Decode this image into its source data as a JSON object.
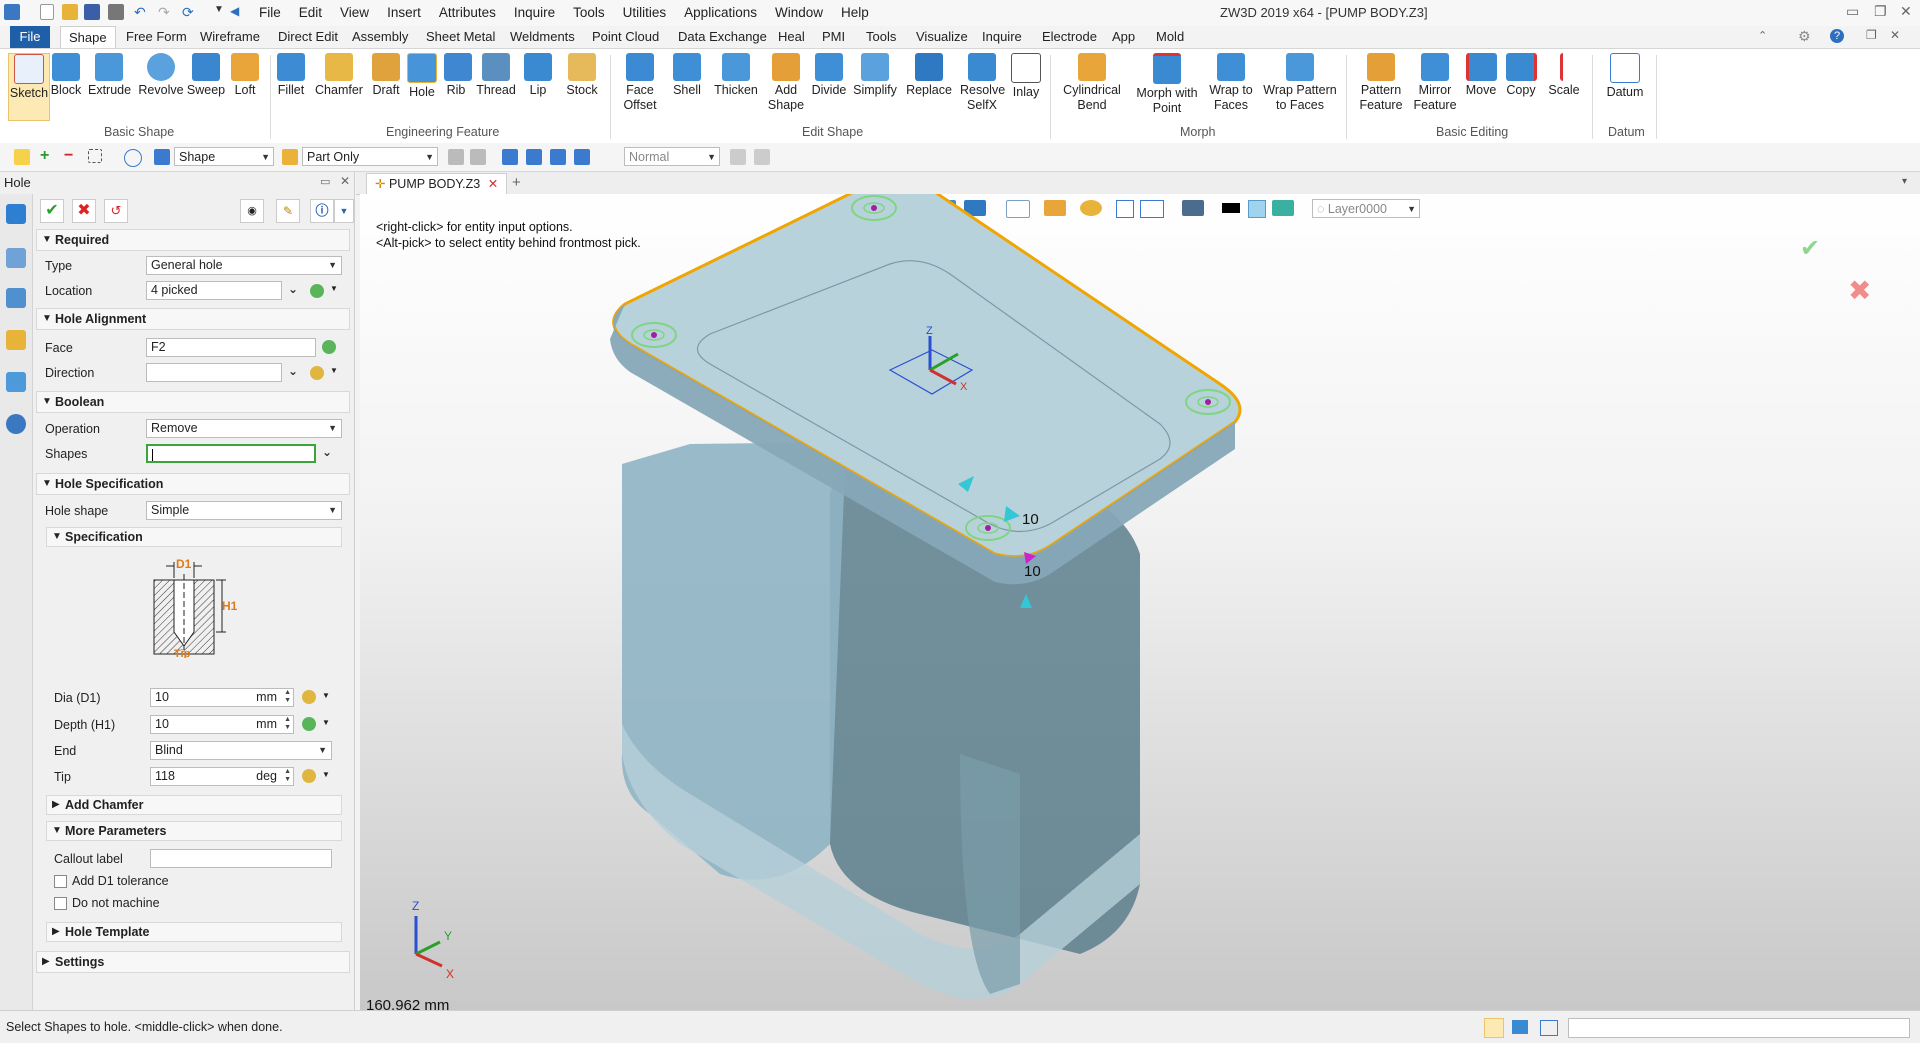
{
  "app": {
    "title": "ZW3D 2019  x64 - [PUMP BODY.Z3]",
    "menu": [
      "File",
      "Edit",
      "View",
      "Insert",
      "Attributes",
      "Inquire",
      "Tools",
      "Utilities",
      "Applications",
      "Window",
      "Help"
    ]
  },
  "ribbon_tabs": [
    "File",
    "Shape",
    "Free Form",
    "Wireframe",
    "Direct Edit",
    "Assembly",
    "Sheet Metal",
    "Weldments",
    "Point Cloud",
    "Data Exchange",
    "Heal",
    "PMI",
    "Tools",
    "Visualize",
    "Inquire",
    "Electrode",
    "App",
    "Mold"
  ],
  "ribbon": {
    "groups": [
      {
        "label": "Basic Shape",
        "buttons": [
          "Sketch",
          "Block",
          "Extrude",
          "Revolve",
          "Sweep",
          "Loft"
        ]
      },
      {
        "label": "Engineering Feature",
        "buttons": [
          "Fillet",
          "Chamfer",
          "Draft",
          "Hole",
          "Rib",
          "Thread",
          "Lip",
          "Stock"
        ]
      },
      {
        "label": "Edit Shape",
        "buttons": [
          "Face Offset",
          "Shell",
          "Thicken",
          "Add Shape",
          "Divide",
          "Simplify",
          "Replace",
          "Resolve SelfX",
          "Inlay"
        ]
      },
      {
        "label": "Morph",
        "buttons": [
          "Cylindrical Bend",
          "Morph with Point",
          "Wrap to Faces",
          "Wrap Pattern to Faces"
        ]
      },
      {
        "label": "Basic Editing",
        "buttons": [
          "Pattern Feature",
          "Mirror Feature",
          "Move",
          "Copy",
          "Scale"
        ]
      },
      {
        "label": "Datum",
        "buttons": [
          "Datum"
        ]
      }
    ]
  },
  "toolbar": {
    "filter_combo": "Shape",
    "scope_combo": "Part Only",
    "render_combo": "Normal"
  },
  "panel": {
    "title": "Hole",
    "required": {
      "header": "Required",
      "type_label": "Type",
      "type_value": "General hole",
      "location_label": "Location",
      "location_value": "4 picked"
    },
    "alignment": {
      "header": "Hole Alignment",
      "face_label": "Face",
      "face_value": "F2",
      "direction_label": "Direction",
      "direction_value": ""
    },
    "boolean": {
      "header": "Boolean",
      "operation_label": "Operation",
      "operation_value": "Remove",
      "shapes_label": "Shapes",
      "shapes_value": ""
    },
    "spec": {
      "header": "Hole Specification",
      "shape_label": "Hole shape",
      "shape_value": "Simple",
      "sub_header": "Specification",
      "diagram_d1": "D1",
      "diagram_h1": "H1",
      "diagram_tip": "Tip",
      "dia_label": "Dia (D1)",
      "dia_value": "10",
      "dia_unit": "mm",
      "depth_label": "Depth (H1)",
      "depth_value": "10",
      "depth_unit": "mm",
      "end_label": "End",
      "end_value": "Blind",
      "tip_label": "Tip",
      "tip_value": "118",
      "tip_unit": "deg"
    },
    "add_chamfer": "Add Chamfer",
    "more": {
      "header": "More Parameters",
      "callout_label": "Callout label",
      "callout_value": "",
      "tol_label": "Add D1 tolerance",
      "nomachine_label": "Do not machine"
    },
    "hole_template": "Hole Template",
    "settings": "Settings"
  },
  "viewport": {
    "doc_tab": "PUMP BODY.Z3",
    "layer": "Layer0000",
    "hint1": "<right-click> for entity input options.",
    "hint2": "<Alt-pick> to select entity behind frontmost pick.",
    "dim_label_1": "10",
    "dim_label_2": "10",
    "measure": "160.962 mm",
    "triad": {
      "x": "X",
      "y": "Y",
      "z": "Z"
    },
    "csys": {
      "x": "X",
      "z": "Z"
    }
  },
  "status": {
    "text": "Select Shapes to hole.  <middle-click> when done."
  },
  "colors": {
    "file_tab": "#1f5fa8",
    "part_fill": "#9fbfcc",
    "edge_highlight": "#f0a500",
    "hole_marker": "#7ed67e"
  }
}
